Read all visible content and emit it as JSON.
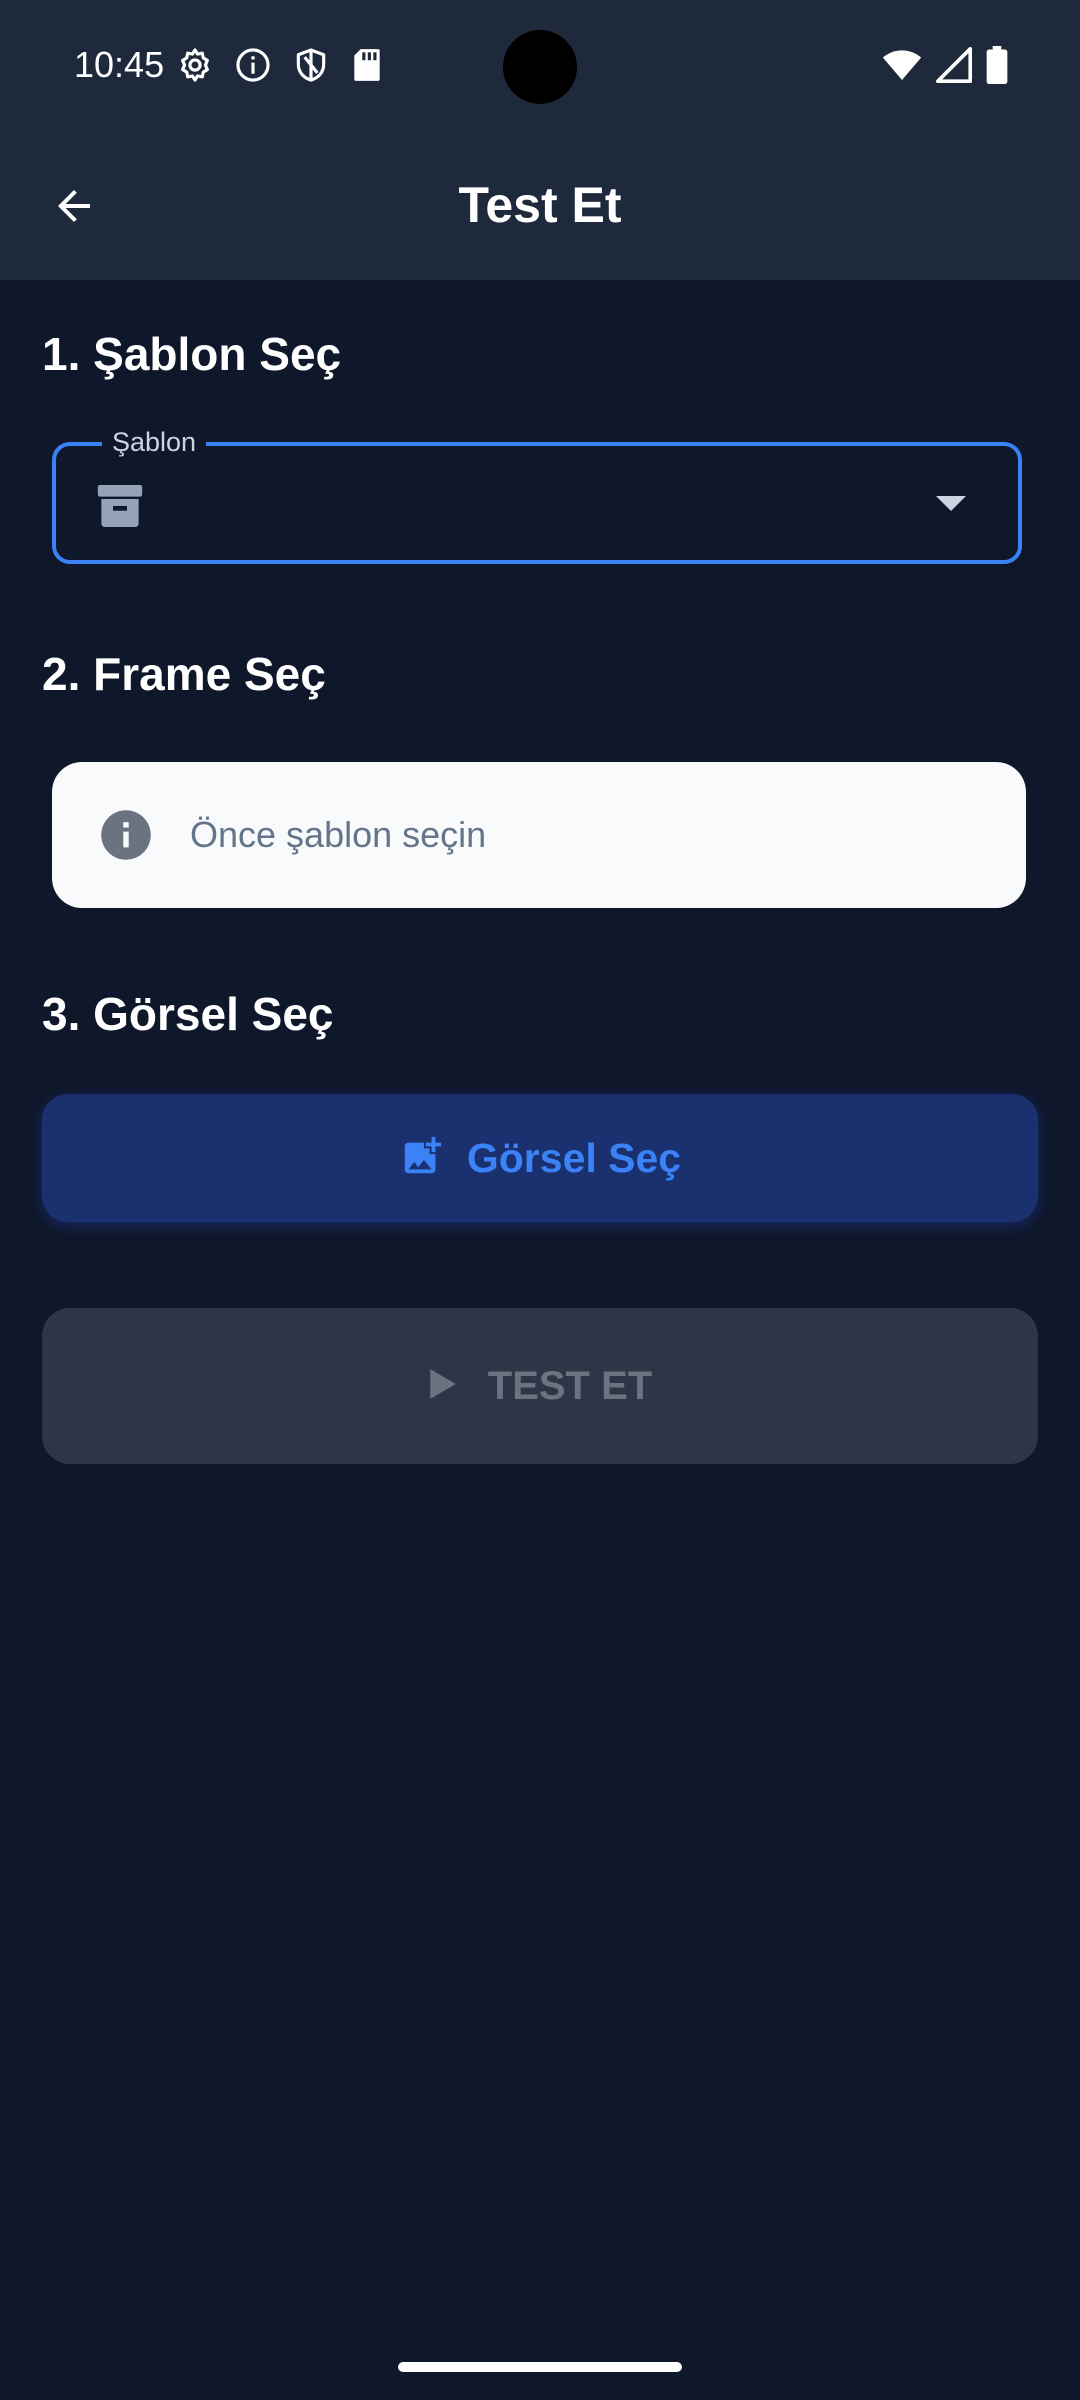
{
  "status_bar": {
    "time": "10:45",
    "left_icons": [
      "gear-icon",
      "info-icon",
      "shield-icon",
      "sd-card-icon"
    ],
    "right_icons": [
      "wifi-icon",
      "signal-icon",
      "battery-icon"
    ]
  },
  "app_bar": {
    "title": "Test Et",
    "back_icon": "arrow-left-icon"
  },
  "sections": {
    "template": {
      "title": "1. Şablon Seç",
      "dropdown_label": "Şablon",
      "dropdown_value": "",
      "icon": "archive-icon"
    },
    "frame": {
      "title": "2. Frame Seç",
      "info_text": "Önce şablon seçin",
      "icon": "info-icon"
    },
    "image": {
      "title": "3. Görsel Seç",
      "button_label": "Görsel Seç",
      "icon": "add-photo-icon"
    }
  },
  "test_button": {
    "label": "TEST ET",
    "icon": "play-icon"
  },
  "colors": {
    "background": "#0f172a",
    "header": "#1e293b",
    "accent": "#3b82f6",
    "disabled": "#2e3546"
  }
}
